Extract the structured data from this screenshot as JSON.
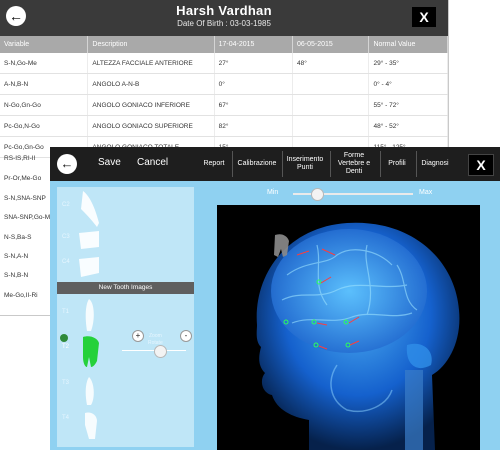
{
  "patient": {
    "name": "Harsh  Vardhan",
    "dob": "Date Of Birth :  03-03-1985"
  },
  "back_window": {
    "back_glyph": "←",
    "close_label": "X",
    "columns": [
      "Variable",
      "Description",
      "17-04-2015",
      "06-05-2015",
      "Normal Value"
    ],
    "rows": [
      [
        "S-N,Go-Me",
        "ALTEZZA FACCIALE ANTERIORE",
        "27°",
        "48°",
        "29° - 35°"
      ],
      [
        "A-N,B-N",
        "ANGOLO A-N-B",
        "0°",
        "",
        "0° - 4°"
      ],
      [
        "N-Go,Gn-Go",
        "ANGOLO GONIACO INFERIORE",
        "67°",
        "",
        "55° - 72°"
      ],
      [
        "Pc-Go,N-Go",
        "ANGOLO GONIACO SUPERIORE",
        "82°",
        "",
        "48° - 52°"
      ],
      [
        "Pc-Go,Gn-Go",
        "ANGOLO GONIACO TOTALE",
        "15°",
        "",
        "115° - 125°"
      ]
    ],
    "hidden_variables": [
      "RS-IS,RI-II",
      "Pr-Or,Me-Go",
      "S-N,SNA-SNP",
      "SNA-SNP,Go-Me",
      "N-S,Ba-S",
      "S-N,A-N",
      "S-N,B-N",
      "Me-Go,II-Ri"
    ]
  },
  "toolbar": {
    "save": "Save",
    "cancel": "Cancel",
    "buttons": [
      "Report",
      "Calibrazione",
      "Inserimento Punti",
      "Forme Vertebre e Denti",
      "Profili",
      "Diagnosi"
    ],
    "close": "X",
    "back_glyph": "←"
  },
  "teeth_panel": {
    "labels_top": [
      "C2",
      "C3",
      "C4"
    ],
    "header": "New Tooth Images",
    "labels_bottom": [
      "T1",
      "T2",
      "T3",
      "T4"
    ],
    "selected": "T2",
    "zoom_label": "Zoom",
    "rotate_label": "Rotate",
    "plus": "+",
    "minus": "-"
  },
  "viewer": {
    "min_label": "Min",
    "max_label": "Max",
    "slider_value": 0.2
  },
  "colors": {
    "toolbar": "#1e1e1e",
    "panel_bg": "#8fd1f1",
    "header_gray": "#a9a9a9",
    "selected_tooth": "#25d13a"
  }
}
